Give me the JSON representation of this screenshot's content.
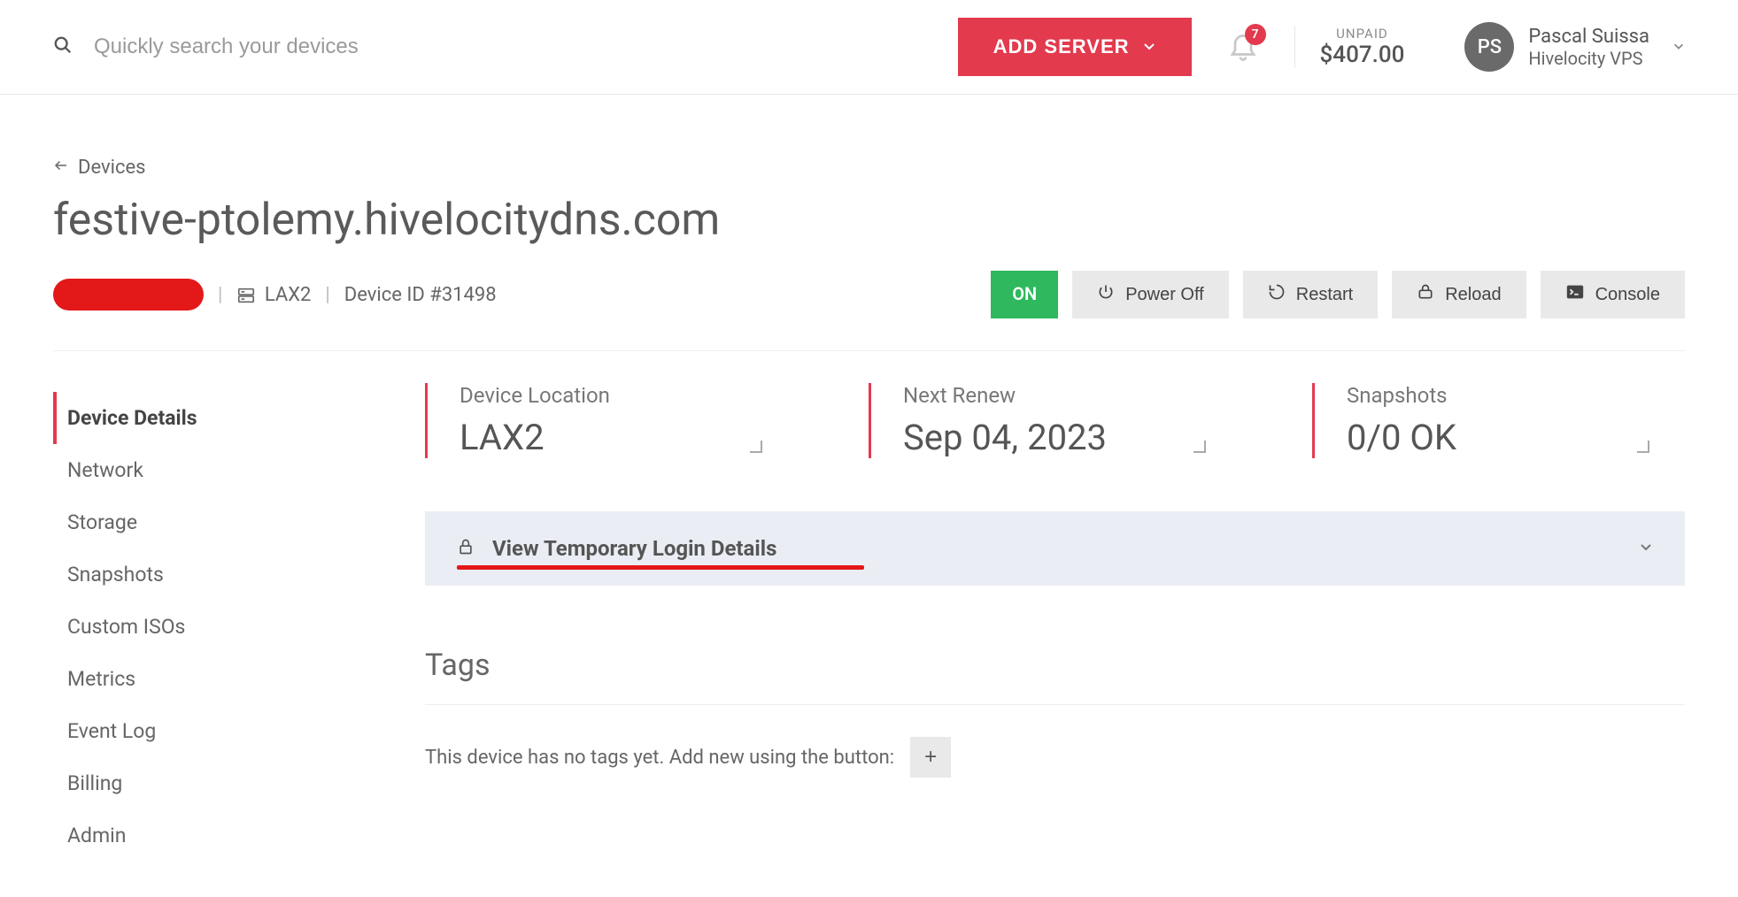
{
  "header": {
    "search_placeholder": "Quickly search your devices",
    "add_server_label": "ADD SERVER",
    "notification_count": "7",
    "unpaid_label": "UNPAID",
    "unpaid_value": "$407.00",
    "user_initials": "PS",
    "user_name": "Pascal Suissa",
    "user_org": "Hivelocity VPS"
  },
  "breadcrumb": {
    "back_label": "Devices"
  },
  "device": {
    "hostname": "festive-ptolemy.hivelocitydns.com",
    "location_short": "LAX2",
    "id_label": "Device ID #31498"
  },
  "actions": {
    "on": "ON",
    "power_off": "Power Off",
    "restart": "Restart",
    "reload": "Reload",
    "console": "Console"
  },
  "sidebar": {
    "items": [
      "Device Details",
      "Network",
      "Storage",
      "Snapshots",
      "Custom ISOs",
      "Metrics",
      "Event Log",
      "Billing",
      "Admin"
    ]
  },
  "stats": {
    "location_label": "Device Location",
    "location_value": "LAX2",
    "renew_label": "Next Renew",
    "renew_value": "Sep 04, 2023",
    "snapshots_label": "Snapshots",
    "snapshots_value": "0/0 OK"
  },
  "login_panel": {
    "label": "View Temporary Login Details"
  },
  "tags": {
    "title": "Tags",
    "empty_text": "This device has no tags yet. Add new using the button:",
    "add_glyph": "+"
  }
}
